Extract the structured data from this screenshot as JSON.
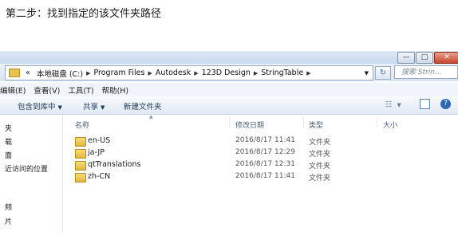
{
  "caption": "第二步：找到指定的该文件夹路径",
  "window": {
    "controls": {
      "minimize": "—",
      "maximize": "□",
      "close": "✕"
    }
  },
  "address": {
    "overflow": "«",
    "crumbs": [
      "本地磁盘 (C:)",
      "Program Files",
      "Autodesk",
      "123D Design",
      "StringTable"
    ],
    "search_placeholder": "搜索 Strin...",
    "refresh_glyph": "↻"
  },
  "menu": [
    "编辑(E)",
    "查看(V)",
    "工具(T)",
    "帮助(H)"
  ],
  "toolbar": {
    "include_library": "包含到库中",
    "share": "共享",
    "new_folder": "新建文件夹"
  },
  "nav": [
    "夹",
    "载",
    "面",
    "近访问的位置",
    "频",
    "片"
  ],
  "columns": {
    "name": "名称",
    "date": "修改日期",
    "type": "类型",
    "size": "大小"
  },
  "files": [
    {
      "name": "en-US",
      "date": "2016/8/17 11:41",
      "type": "文件夹"
    },
    {
      "name": "ja-JP",
      "date": "2016/8/17 12:29",
      "type": "文件夹"
    },
    {
      "name": "qtTranslations",
      "date": "2016/8/17 12:31",
      "type": "文件夹"
    },
    {
      "name": "zh-CN",
      "date": "2016/8/17 11:41",
      "type": "文件夹"
    }
  ],
  "colors": {
    "folder": "#e2b63b",
    "accent": "#3a6fb3",
    "close": "#c7452c"
  }
}
